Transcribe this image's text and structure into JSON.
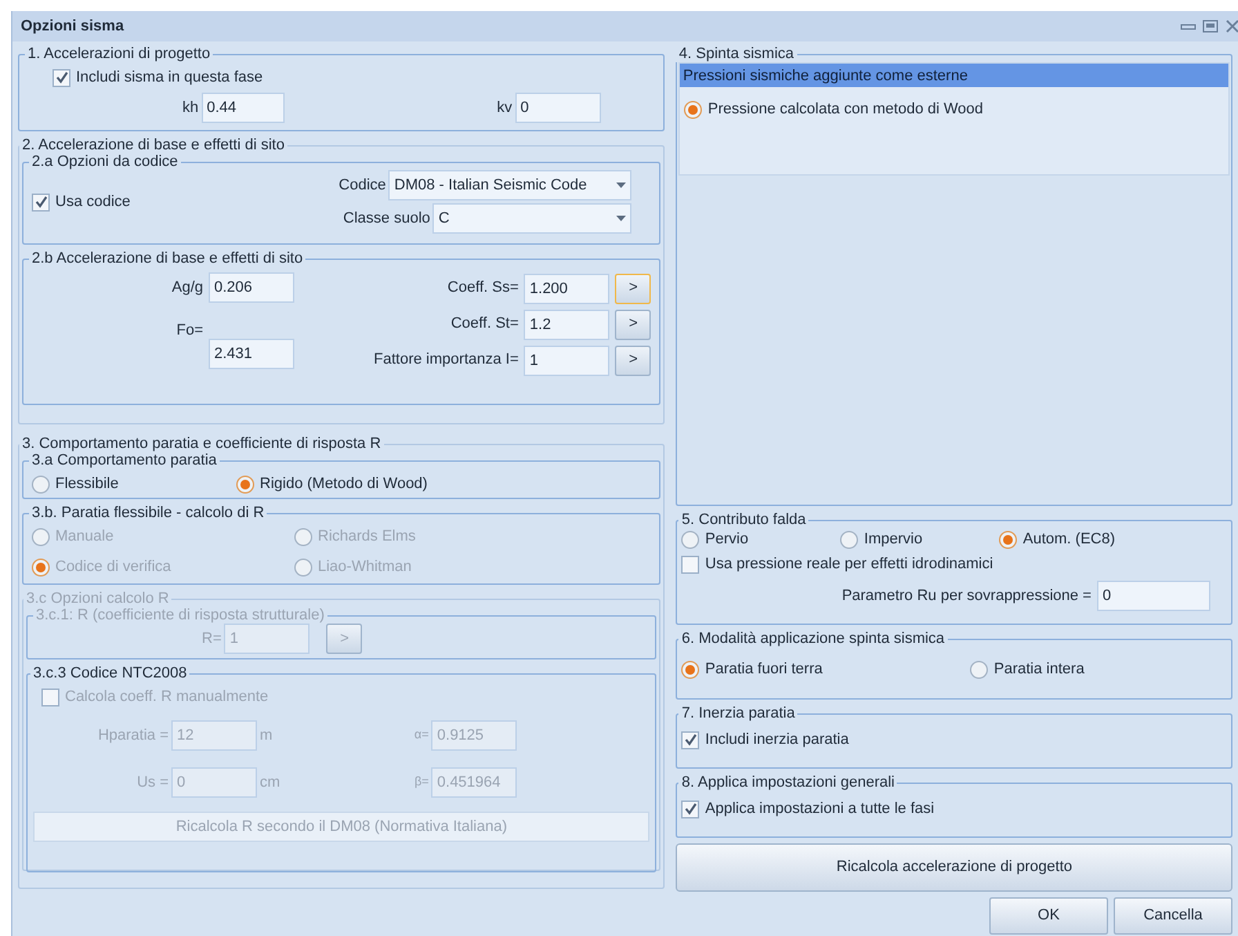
{
  "window": {
    "title": "Opzioni sisma"
  },
  "section_1": {
    "title": "1. Accelerazioni di progetto",
    "include": {
      "label": "Includi sisma in questa fase",
      "checked": true
    },
    "kh": {
      "label": "kh",
      "value": "0.44"
    },
    "kv": {
      "label": "kv",
      "value": "0"
    }
  },
  "section_2": {
    "title": "2. Accelerazione di base e effetti di sito",
    "section_2a": {
      "title": "2.a Opzioni da codice",
      "use_code": {
        "label": "Usa codice",
        "checked": true
      },
      "code": {
        "label": "Codice",
        "value": "DM08 - Italian Seismic Code"
      },
      "soil_class": {
        "label": "Classe suolo",
        "value": "C"
      }
    },
    "section_2b": {
      "title": "2.b Accelerazione di base e effetti di sito",
      "ag": {
        "label": "Ag/g",
        "value": "0.206"
      },
      "fo": {
        "label": "Fo=",
        "value": "2.431"
      },
      "coefficients": [
        {
          "label": "Coeff. Ss=",
          "value": "1.200",
          "button": ">",
          "focused": true
        },
        {
          "label": "Coeff. St=",
          "value": "1.2",
          "button": ">",
          "focused": false
        },
        {
          "label": "Fattore importanza I=",
          "value": "1",
          "button": ">",
          "focused": false
        }
      ]
    }
  },
  "section_3": {
    "title": "3. Comportamento paratia e coefficiente di risposta R",
    "section_3a": {
      "title": "3.a Comportamento paratia",
      "options": [
        {
          "label": "Flessibile",
          "selected": false
        },
        {
          "label": "Rigido (Metodo di Wood)",
          "selected": true
        }
      ]
    },
    "section_3b": {
      "title": "3.b. Paratia flessibile - calcolo di R",
      "disabled": true,
      "options": [
        {
          "label": "Manuale",
          "selected": false
        },
        {
          "label": "Richards Elms",
          "selected": false
        },
        {
          "label": "Codice di verifica",
          "selected": true
        },
        {
          "label": "Liao-Whitman",
          "selected": false
        }
      ]
    },
    "section_3c": {
      "title": "3.c Opzioni calcolo R",
      "disabled": true,
      "section_3c1": {
        "title": "3.c.1: R (coefficiente di risposta strutturale)",
        "r": {
          "label": "R=",
          "value": "1",
          "button": ">"
        }
      },
      "section_3c3": {
        "title": "3.c.3 Codice NTC2008",
        "manual": {
          "label": "Calcola coeff. R manualmente",
          "checked": false
        },
        "h": {
          "label": "Hparatia =",
          "value": "12",
          "unit": "m"
        },
        "alpha": {
          "label": "α=",
          "value": "0.9125"
        },
        "us": {
          "label": "Us =",
          "value": "0",
          "unit": "cm"
        },
        "beta": {
          "label": "β=",
          "value": "0.451964"
        },
        "button": "Ricalcola R secondo il DM08 (Normativa Italiana)"
      }
    }
  },
  "section_4": {
    "title": "4. Spinta sismica",
    "items": [
      {
        "kind": "list_item",
        "label": "Pressioni sismiche aggiunte come esterne",
        "selected": true
      },
      {
        "kind": "radio",
        "label": "Pressione calcolata con metodo di Wood",
        "selected": true
      }
    ]
  },
  "section_5": {
    "title": "5. Contributo falda",
    "options": [
      {
        "label": "Pervio",
        "selected": false
      },
      {
        "label": "Impervio",
        "selected": false
      },
      {
        "label": "Autom. (EC8)",
        "selected": true
      }
    ],
    "real_pressure": {
      "label": "Usa pressione reale per effetti idrodinamici",
      "checked": false
    },
    "ru": {
      "label": "Parametro Ru per sovrappressione =",
      "value": "0"
    }
  },
  "section_6": {
    "title": "6. Modalità applicazione spinta sismica",
    "options": [
      {
        "label": "Paratia fuori terra",
        "selected": true
      },
      {
        "label": "Paratia intera",
        "selected": false
      }
    ]
  },
  "section_7": {
    "title": "7. Inerzia paratia",
    "include": {
      "label": "Includi inerzia paratia",
      "checked": true
    }
  },
  "section_8": {
    "title": "8. Applica impostazioni generali",
    "apply_all": {
      "label": "Applica impostazioni a tutte le fasi",
      "checked": true
    }
  },
  "recalc_button": "Ricalcola accelerazione di progetto",
  "buttons": [
    "OK",
    "Cancella"
  ]
}
